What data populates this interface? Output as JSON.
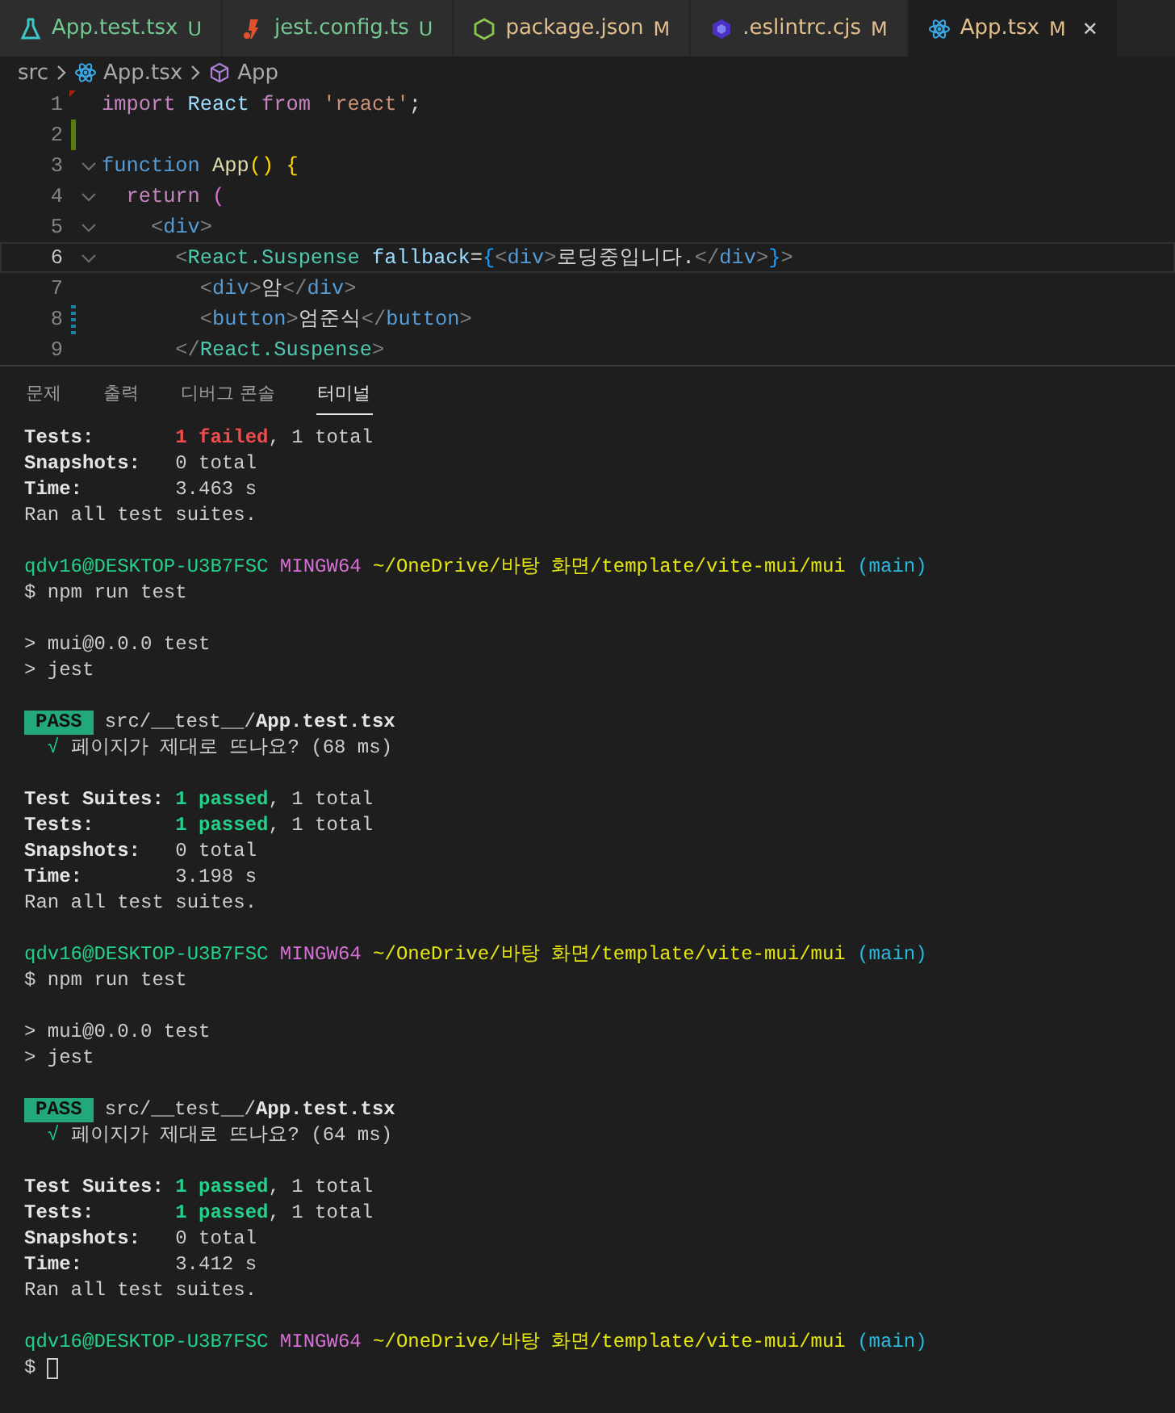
{
  "editor_tabs": [
    {
      "kind": "test",
      "label": "App.test.tsx",
      "status": "U",
      "color": "#73c991",
      "selected": false
    },
    {
      "kind": "jest",
      "label": "jest.config.ts",
      "status": "U",
      "color": "#73c991",
      "selected": false
    },
    {
      "kind": "node",
      "label": "package.json",
      "status": "M",
      "color": "#e2c08d",
      "selected": false
    },
    {
      "kind": "eslint",
      "label": ".eslintrc.cjs",
      "status": "M",
      "color": "#e2c08d",
      "selected": false
    },
    {
      "kind": "react",
      "label": "App.tsx",
      "status": "M",
      "color": "#e2c08d",
      "selected": true,
      "close": "✕"
    }
  ],
  "breadcrumb": [
    {
      "kind": "folder",
      "label": "src"
    },
    {
      "kind": "react",
      "label": "App.tsx"
    },
    {
      "kind": "symbol",
      "label": "App"
    }
  ],
  "code_lines": [
    {
      "number": "1",
      "added": false,
      "modified": false,
      "deleted": true,
      "foldable": false,
      "current": false,
      "tokens": [
        {
          "t": "import",
          "color": "#c586c0"
        },
        {
          "t": " React ",
          "color": "#9cdcfe"
        },
        {
          "t": "from",
          "color": "#c586c0"
        },
        {
          "t": " 'react'",
          "color": "#ce9178"
        },
        {
          "t": ";",
          "color": "#d4d4d4"
        }
      ]
    },
    {
      "number": "2",
      "added": true,
      "modified": false,
      "deleted": false,
      "foldable": false,
      "current": false
    },
    {
      "number": "3",
      "added": false,
      "modified": false,
      "deleted": false,
      "foldable": true,
      "current": false,
      "tokens": [
        {
          "t": "function",
          "color": "#569cd6"
        },
        {
          "t": " App",
          "color": "#dcdcaa"
        },
        {
          "t": "() {",
          "color": "#ffd700"
        }
      ]
    },
    {
      "number": "4",
      "added": false,
      "modified": false,
      "deleted": false,
      "foldable": true,
      "current": false,
      "tokens": [
        {
          "t": "  return",
          "color": "#c586c0"
        },
        {
          "t": " (",
          "color": "#da70d6"
        }
      ]
    },
    {
      "number": "5",
      "added": false,
      "modified": false,
      "deleted": false,
      "foldable": true,
      "current": false,
      "tokens": [
        {
          "t": "    <",
          "color": "#808080"
        },
        {
          "t": "div",
          "color": "#569cd6"
        },
        {
          "t": ">",
          "color": "#808080"
        }
      ]
    },
    {
      "number": "6",
      "added": false,
      "modified": false,
      "deleted": false,
      "foldable": true,
      "current": true,
      "tokens": [
        {
          "t": "      <",
          "color": "#808080"
        },
        {
          "t": "React.Suspense",
          "color": "#4ec9b0"
        },
        {
          "t": " fallback",
          "color": "#9cdcfe"
        },
        {
          "t": "=",
          "color": "#d4d4d4"
        },
        {
          "t": "{",
          "color": "#179fff"
        },
        {
          "t": "<",
          "color": "#808080"
        },
        {
          "t": "div",
          "color": "#569cd6"
        },
        {
          "t": ">",
          "color": "#808080"
        },
        {
          "t": "로딩중입니다.",
          "color": "#d4d4d4"
        },
        {
          "t": "</",
          "color": "#808080"
        },
        {
          "t": "div",
          "color": "#569cd6"
        },
        {
          "t": ">",
          "color": "#808080"
        },
        {
          "t": "}",
          "color": "#179fff"
        },
        {
          "t": ">",
          "color": "#808080"
        }
      ]
    },
    {
      "number": "7",
      "added": false,
      "modified": false,
      "deleted": false,
      "foldable": false,
      "current": false,
      "tokens": [
        {
          "t": "        <",
          "color": "#808080"
        },
        {
          "t": "div",
          "color": "#569cd6"
        },
        {
          "t": ">",
          "color": "#808080"
        },
        {
          "t": "암",
          "color": "#d4d4d4"
        },
        {
          "t": "</",
          "color": "#808080"
        },
        {
          "t": "div",
          "color": "#569cd6"
        },
        {
          "t": ">",
          "color": "#808080"
        }
      ]
    },
    {
      "number": "8",
      "added": false,
      "modified": true,
      "deleted": false,
      "foldable": false,
      "current": false,
      "tokens": [
        {
          "t": "        <",
          "color": "#808080"
        },
        {
          "t": "button",
          "color": "#569cd6"
        },
        {
          "t": ">",
          "color": "#808080"
        },
        {
          "t": "엄준식",
          "color": "#d4d4d4"
        },
        {
          "t": "</",
          "color": "#808080"
        },
        {
          "t": "button",
          "color": "#569cd6"
        },
        {
          "t": ">",
          "color": "#808080"
        }
      ]
    },
    {
      "number": "9",
      "added": false,
      "modified": false,
      "deleted": false,
      "foldable": false,
      "current": false,
      "tokens": [
        {
          "t": "      </",
          "color": "#808080"
        },
        {
          "t": "React.Suspense",
          "color": "#4ec9b0"
        },
        {
          "t": ">",
          "color": "#808080"
        }
      ]
    }
  ],
  "panel_tabs": [
    {
      "label": "문제",
      "selected": false
    },
    {
      "label": "출력",
      "selected": false
    },
    {
      "label": "디버그 콘솔",
      "selected": false
    },
    {
      "label": "터미널",
      "selected": true
    }
  ],
  "terminal_lines": [
    {
      "kind": "text",
      "segments": [
        {
          "kind": "label",
          "t": "Tests:",
          "color": "#e5e5e5"
        },
        {
          "kind": "bold",
          "t": "1 failed",
          "color": "#f14c4c"
        },
        {
          "kind": "text",
          "t": ", 1 total",
          "color": "#cccccc"
        }
      ]
    },
    {
      "kind": "text",
      "segments": [
        {
          "kind": "label",
          "t": "Snapshots:",
          "color": "#e5e5e5"
        },
        {
          "kind": "text",
          "t": "0 total",
          "color": "#cccccc"
        }
      ]
    },
    {
      "kind": "text",
      "segments": [
        {
          "kind": "label",
          "t": "Time:",
          "color": "#e5e5e5"
        },
        {
          "kind": "text",
          "t": "3.463 s",
          "color": "#cccccc"
        }
      ]
    },
    {
      "kind": "text",
      "segments": [
        {
          "kind": "text",
          "t": "Ran all test suites.",
          "color": "#cccccc"
        }
      ]
    },
    {
      "kind": "blank"
    },
    {
      "kind": "text",
      "segments": [
        {
          "kind": "text",
          "t": "qdv16@DESKTOP-U3B7FSC",
          "color": "#23d18b"
        },
        {
          "kind": "text",
          "t": " MINGW64",
          "color": "#d670d6"
        },
        {
          "kind": "text",
          "t": " ~/OneDrive/바탕 화면/template/vite-mui/mui",
          "color": "#e5e510"
        },
        {
          "kind": "text",
          "t": " (main)",
          "color": "#29b8db"
        }
      ]
    },
    {
      "kind": "text",
      "segments": [
        {
          "kind": "text",
          "t": "$ npm run test",
          "color": "#cccccc"
        }
      ]
    },
    {
      "kind": "blank"
    },
    {
      "kind": "text",
      "segments": [
        {
          "kind": "text",
          "t": "> mui@0.0.0 test",
          "color": "#cccccc"
        }
      ]
    },
    {
      "kind": "text",
      "segments": [
        {
          "kind": "text",
          "t": "> jest",
          "color": "#cccccc"
        }
      ]
    },
    {
      "kind": "blank"
    },
    {
      "kind": "text",
      "segments": [
        {
          "kind": "badge",
          "t": "PASS",
          "color": "#23a87a"
        },
        {
          "kind": "text",
          "t": "src/__test__/",
          "color": "#cccccc"
        },
        {
          "kind": "bold",
          "t": "App.test.tsx",
          "color": "#e5e5e5"
        }
      ]
    },
    {
      "kind": "text",
      "segments": [
        {
          "kind": "text",
          "t": "  √",
          "color": "#23d18b"
        },
        {
          "kind": "text",
          "t": " 페이지가 제대로 뜨나요? (68 ms)",
          "color": "#cccccc"
        }
      ]
    },
    {
      "kind": "blank"
    },
    {
      "kind": "text",
      "segments": [
        {
          "kind": "label",
          "t": "Test Suites:",
          "color": "#e5e5e5"
        },
        {
          "kind": "bold",
          "t": "1 passed",
          "color": "#23d18b"
        },
        {
          "kind": "text",
          "t": ", 1 total",
          "color": "#cccccc"
        }
      ]
    },
    {
      "kind": "text",
      "segments": [
        {
          "kind": "label",
          "t": "Tests:",
          "color": "#e5e5e5"
        },
        {
          "kind": "bold",
          "t": "1 passed",
          "color": "#23d18b"
        },
        {
          "kind": "text",
          "t": ", 1 total",
          "color": "#cccccc"
        }
      ]
    },
    {
      "kind": "text",
      "segments": [
        {
          "kind": "label",
          "t": "Snapshots:",
          "color": "#e5e5e5"
        },
        {
          "kind": "text",
          "t": "0 total",
          "color": "#cccccc"
        }
      ]
    },
    {
      "kind": "text",
      "segments": [
        {
          "kind": "label",
          "t": "Time:",
          "color": "#e5e5e5"
        },
        {
          "kind": "text",
          "t": "3.198 s",
          "color": "#cccccc"
        }
      ]
    },
    {
      "kind": "text",
      "segments": [
        {
          "kind": "text",
          "t": "Ran all test suites.",
          "color": "#cccccc"
        }
      ]
    },
    {
      "kind": "blank"
    },
    {
      "kind": "text",
      "segments": [
        {
          "kind": "text",
          "t": "qdv16@DESKTOP-U3B7FSC",
          "color": "#23d18b"
        },
        {
          "kind": "text",
          "t": " MINGW64",
          "color": "#d670d6"
        },
        {
          "kind": "text",
          "t": " ~/OneDrive/바탕 화면/template/vite-mui/mui",
          "color": "#e5e510"
        },
        {
          "kind": "text",
          "t": " (main)",
          "color": "#29b8db"
        }
      ]
    },
    {
      "kind": "text",
      "segments": [
        {
          "kind": "text",
          "t": "$ npm run test",
          "color": "#cccccc"
        }
      ]
    },
    {
      "kind": "blank"
    },
    {
      "kind": "text",
      "segments": [
        {
          "kind": "text",
          "t": "> mui@0.0.0 test",
          "color": "#cccccc"
        }
      ]
    },
    {
      "kind": "text",
      "segments": [
        {
          "kind": "text",
          "t": "> jest",
          "color": "#cccccc"
        }
      ]
    },
    {
      "kind": "blank"
    },
    {
      "kind": "text",
      "segments": [
        {
          "kind": "badge",
          "t": "PASS",
          "color": "#23a87a"
        },
        {
          "kind": "text",
          "t": "src/__test__/",
          "color": "#cccccc"
        },
        {
          "kind": "bold",
          "t": "App.test.tsx",
          "color": "#e5e5e5"
        }
      ]
    },
    {
      "kind": "text",
      "segments": [
        {
          "kind": "text",
          "t": "  √",
          "color": "#23d18b"
        },
        {
          "kind": "text",
          "t": " 페이지가 제대로 뜨나요? (64 ms)",
          "color": "#cccccc"
        }
      ]
    },
    {
      "kind": "blank"
    },
    {
      "kind": "text",
      "segments": [
        {
          "kind": "label",
          "t": "Test Suites:",
          "color": "#e5e5e5"
        },
        {
          "kind": "bold",
          "t": "1 passed",
          "color": "#23d18b"
        },
        {
          "kind": "text",
          "t": ", 1 total",
          "color": "#cccccc"
        }
      ]
    },
    {
      "kind": "text",
      "segments": [
        {
          "kind": "label",
          "t": "Tests:",
          "color": "#e5e5e5"
        },
        {
          "kind": "bold",
          "t": "1 passed",
          "color": "#23d18b"
        },
        {
          "kind": "text",
          "t": ", 1 total",
          "color": "#cccccc"
        }
      ]
    },
    {
      "kind": "text",
      "segments": [
        {
          "kind": "label",
          "t": "Snapshots:",
          "color": "#e5e5e5"
        },
        {
          "kind": "text",
          "t": "0 total",
          "color": "#cccccc"
        }
      ]
    },
    {
      "kind": "text",
      "segments": [
        {
          "kind": "label",
          "t": "Time:",
          "color": "#e5e5e5"
        },
        {
          "kind": "text",
          "t": "3.412 s",
          "color": "#cccccc"
        }
      ]
    },
    {
      "kind": "text",
      "segments": [
        {
          "kind": "text",
          "t": "Ran all test suites.",
          "color": "#cccccc"
        }
      ]
    },
    {
      "kind": "blank"
    },
    {
      "kind": "text",
      "segments": [
        {
          "kind": "text",
          "t": "qdv16@DESKTOP-U3B7FSC",
          "color": "#23d18b"
        },
        {
          "kind": "text",
          "t": " MINGW64",
          "color": "#d670d6"
        },
        {
          "kind": "text",
          "t": " ~/OneDrive/바탕 화면/template/vite-mui/mui",
          "color": "#e5e510"
        },
        {
          "kind": "text",
          "t": " (main)",
          "color": "#29b8db"
        }
      ]
    },
    {
      "kind": "text",
      "segments": [
        {
          "kind": "text",
          "t": "$",
          "color": "#cccccc"
        },
        {
          "kind": "cursor",
          "color": "#cccccc"
        }
      ]
    }
  ]
}
